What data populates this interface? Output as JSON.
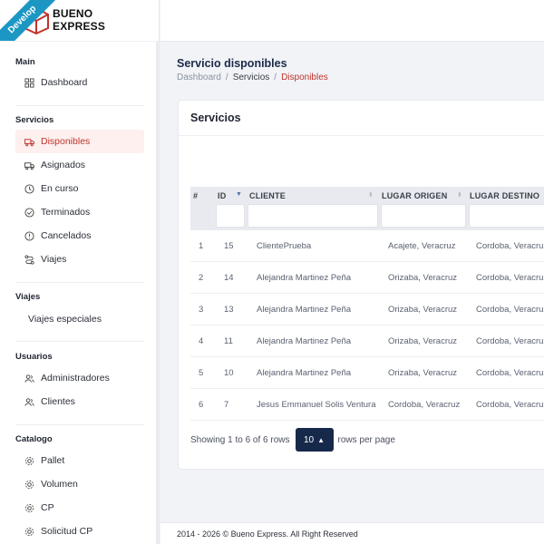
{
  "brand": {
    "ribbon": "Develop",
    "name_line1": "BUENO",
    "name_line2": "EXPRESS"
  },
  "sidebar": {
    "sections": {
      "main": "Main",
      "servicios": "Servicios",
      "viajes": "Viajes",
      "usuarios": "Usuarios",
      "catalogo": "Catalogo"
    },
    "items": {
      "dashboard": "Dashboard",
      "disponibles": "Disponibles",
      "asignados": "Asignados",
      "en_curso": "En curso",
      "terminados": "Terminados",
      "cancelados": "Cancelados",
      "viajes": "Viajes",
      "viajes_especiales": "Viajes especiales",
      "administradores": "Administradores",
      "clientes": "Clientes",
      "pallet": "Pallet",
      "volumen": "Volumen",
      "cp": "CP",
      "solicitud_cp": "Solicitud CP"
    }
  },
  "page": {
    "title": "Servicio disponibles",
    "breadcrumb": {
      "home": "Dashboard",
      "section": "Servicios",
      "current": "Disponibles",
      "separator": "/"
    }
  },
  "card": {
    "title": "Servicios",
    "columns": {
      "num": "#",
      "id": "ID",
      "cliente": "CLIENTE",
      "origen": "LUGAR ORIGEN",
      "destino": "LUGAR DESTINO"
    },
    "rows": [
      {
        "num": "1",
        "id": "15",
        "cliente": "ClientePrueba",
        "origen": "Acajete, Veracruz",
        "destino": "Cordoba, Veracruz"
      },
      {
        "num": "2",
        "id": "14",
        "cliente": "Alejandra Martinez Peña",
        "origen": "Orizaba, Veracruz",
        "destino": "Cordoba, Veracruz"
      },
      {
        "num": "3",
        "id": "13",
        "cliente": "Alejandra Martinez Peña",
        "origen": "Orizaba, Veracruz",
        "destino": "Cordoba, Veracruz"
      },
      {
        "num": "4",
        "id": "11",
        "cliente": "Alejandra Martinez Peña",
        "origen": "Orizaba, Veracruz",
        "destino": "Cordoba, Veracruz"
      },
      {
        "num": "5",
        "id": "10",
        "cliente": "Alejandra Martinez Peña",
        "origen": "Orizaba, Veracruz",
        "destino": "Cordoba, Veracruz"
      },
      {
        "num": "6",
        "id": "7",
        "cliente": "Jesus Emmanuel Solis Ventura",
        "origen": "Cordoba, Veracruz",
        "destino": "Cordoba, Veracruz"
      }
    ],
    "pager": {
      "showing": "Showing 1 to 6 of 6 rows",
      "page_size": "10",
      "suffix": "rows per page"
    }
  },
  "footer": {
    "text": "2014 - 2026 © Bueno Express. All Right Reserved"
  },
  "colors": {
    "accent": "#c0332b",
    "navy": "#17294a",
    "ribbon": "#1c97c4"
  }
}
